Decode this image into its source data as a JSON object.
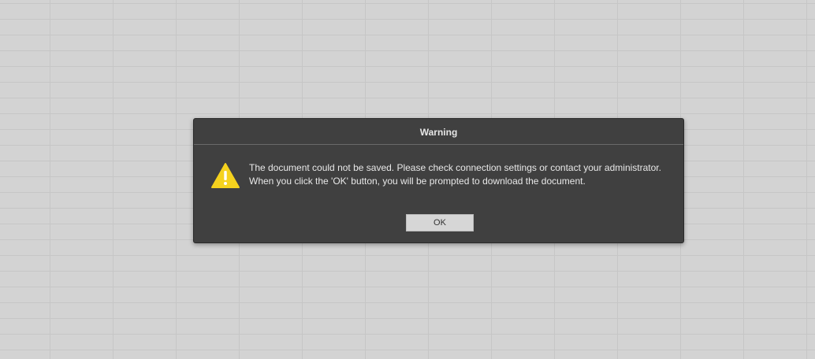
{
  "dialog": {
    "title": "Warning",
    "icon": "warning-icon",
    "message_line1": "The document could not be saved. Please check connection settings or contact your administrator.",
    "message_line2": "When you click the 'OK' button, you will be prompted to download the document.",
    "ok_label": "OK"
  },
  "colors": {
    "dialog_background": "#404040",
    "warning_yellow": "#f5d21e",
    "backdrop": "#d3d3d3"
  }
}
